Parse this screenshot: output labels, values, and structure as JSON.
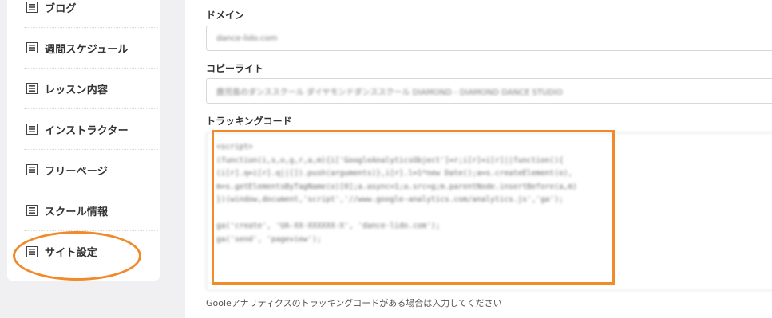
{
  "sidebar": {
    "items": [
      {
        "label": "ブログ",
        "icon": "list-icon"
      },
      {
        "label": "週間スケジュール",
        "icon": "list-icon"
      },
      {
        "label": "レッスン内容",
        "icon": "list-icon"
      },
      {
        "label": "インストラクター",
        "icon": "list-icon"
      },
      {
        "label": "フリーページ",
        "icon": "list-icon"
      },
      {
        "label": "スクール情報",
        "icon": "list-icon"
      },
      {
        "label": "サイト設定",
        "icon": "list-icon"
      }
    ]
  },
  "form": {
    "domain": {
      "label": "ドメイン",
      "value": "dance-lido.com"
    },
    "copyright": {
      "label": "コピーライト",
      "value": "鹿児島のダンススクール ダイヤモンドダンススクール DIAMOND - DIAMOND DANCE STUDIO"
    },
    "tracking": {
      "label": "トラッキングコード",
      "code_lines": [
        "<script>",
        "(function(i,s,o,g,r,a,m){i['GoogleAnalyticsObject']=r;i[r]=i[r]||function(){",
        "(i[r].q=i[r].q||[]).push(arguments)},i[r].l=1*new Date();a=s.createElement(o),",
        "m=s.getElementsByTagName(o)[0];a.async=1;a.src=g;m.parentNode.insertBefore(a,m)",
        "})(window,document,'script','//www.google-analytics.com/analytics.js','ga');",
        "",
        "ga('create', 'UA-XX-XXXXXX-X', 'dance-lido.com');",
        "ga('send', 'pageview');"
      ],
      "help": "Gooleアナリティクスのトラッキングコードがある場合は入力してください"
    }
  },
  "colors": {
    "highlight": "#f08a2a",
    "background": "#f0f0f2"
  }
}
